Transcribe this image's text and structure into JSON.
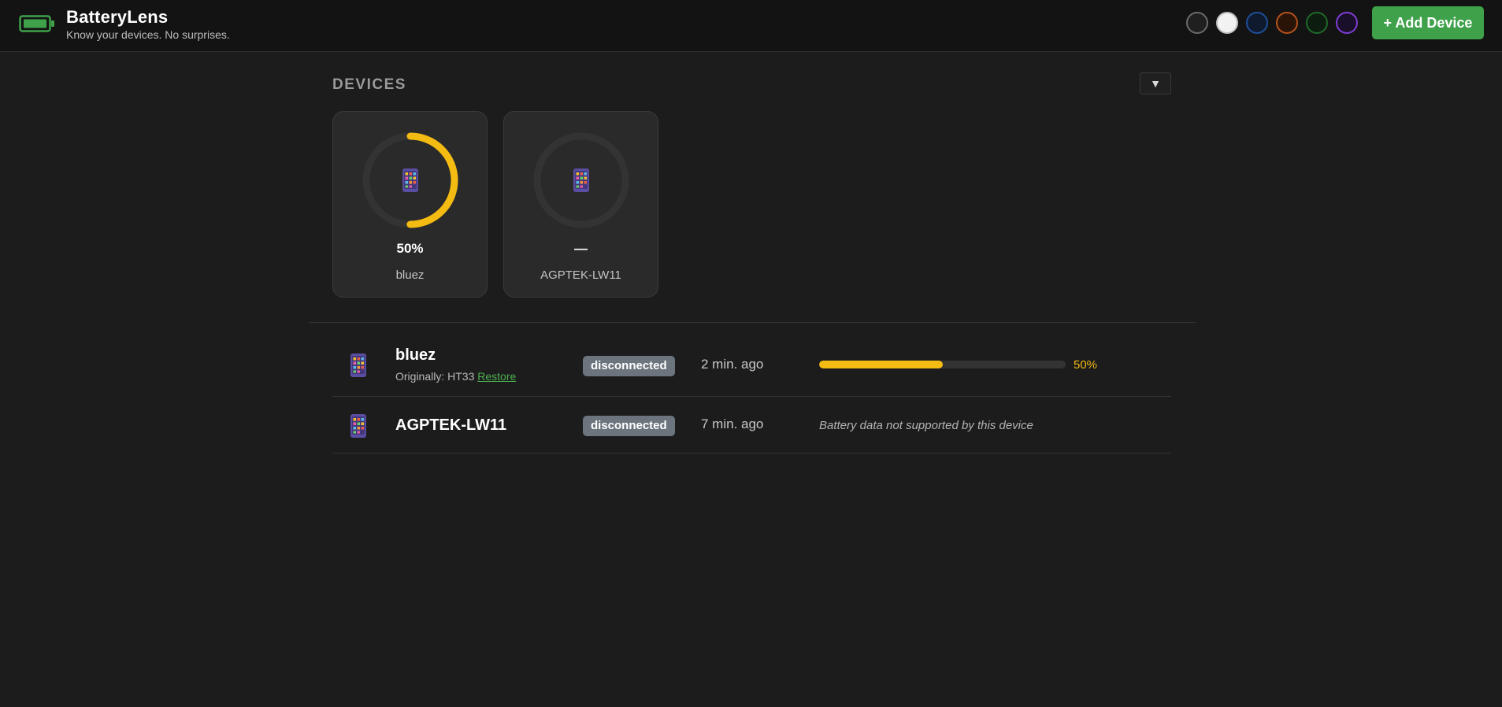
{
  "app": {
    "title": "BatteryLens",
    "tagline": "Know your devices. No surprises.",
    "accent": "#3fa14a"
  },
  "header": {
    "theme_swatches": [
      {
        "fill": "#1f1f1f",
        "border": "#6a6a6a"
      },
      {
        "fill": "#f2f2f2",
        "border": "#bdbdbd"
      },
      {
        "fill": "#0f1a2e",
        "border": "#1d4f9a"
      },
      {
        "fill": "#2a1408",
        "border": "#b4521a"
      },
      {
        "fill": "#0c1c0f",
        "border": "#1f6a2a"
      },
      {
        "fill": "#1a0f2a",
        "border": "#7d3dd4"
      }
    ],
    "add_device_label": "+ Add Device"
  },
  "devices_section": {
    "title": "DEVICES",
    "collapse_glyph": "▼",
    "ring_track_color": "#333333",
    "ring_fill_color": "#f4bc12"
  },
  "cards": [
    {
      "name": "bluez",
      "level_text": "50%",
      "level": 50,
      "icon": "mobile-phone-icon"
    },
    {
      "name": "AGPTEK-LW11",
      "level_text": "—",
      "level": null,
      "icon": "mobile-phone-icon"
    }
  ],
  "rows": [
    {
      "name": "bluez",
      "original_prefix": "Originally: HT33",
      "restore_label": "Restore",
      "status": "disconnected",
      "last_seen": "2 min. ago",
      "battery_text": "50%",
      "battery_fraction": 0.5,
      "icon": "mobile-phone-icon"
    },
    {
      "name": "AGPTEK-LW11",
      "status": "disconnected",
      "last_seen": "7 min. ago",
      "battery_note": "Battery data not supported by this device",
      "icon": "mobile-phone-icon"
    }
  ]
}
